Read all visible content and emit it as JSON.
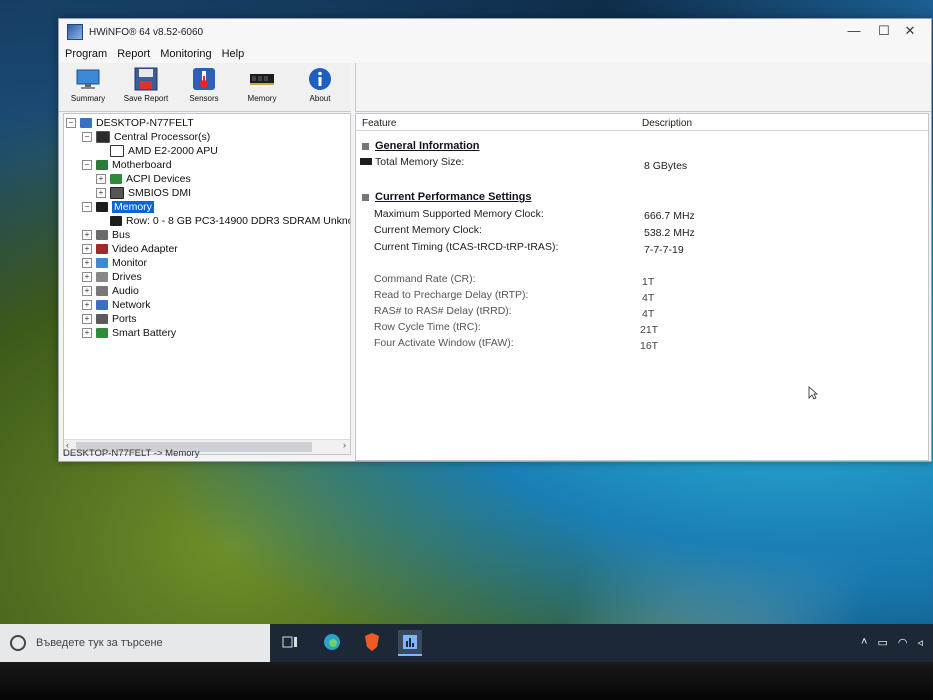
{
  "window": {
    "title": "HWiNFO® 64 v8.52-6060",
    "controls": {
      "minimize": "—",
      "maximize": "☐",
      "close": "✕"
    }
  },
  "menu": [
    "Program",
    "Report",
    "Monitoring",
    "Help"
  ],
  "toolbar": [
    {
      "label": "Summary",
      "icon": "summary-monitor-icon"
    },
    {
      "label": "Save Report",
      "icon": "floppy-disk-icon"
    },
    {
      "label": "Sensors",
      "icon": "thermometer-icon"
    },
    {
      "label": "Memory",
      "icon": "ram-module-icon"
    },
    {
      "label": "About",
      "icon": "info-icon"
    }
  ],
  "tree": {
    "root": "DESKTOP-N77FELT",
    "items": [
      {
        "label": "Central Processor(s)",
        "icon": "cpu-icon"
      },
      {
        "label": "AMD E2-2000 APU",
        "icon": "cpu-chip-icon"
      },
      {
        "label": "Motherboard",
        "icon": "motherboard-icon"
      },
      {
        "label": "ACPI Devices",
        "icon": "acpi-icon"
      },
      {
        "label": "SMBIOS DMI",
        "icon": "smbios-icon"
      },
      {
        "label": "Memory",
        "icon": "memory-icon"
      },
      {
        "label": "Row: 0 - 8 GB PC3-14900 DDR3 SDRAM Unkno",
        "icon": "ram-row-icon"
      },
      {
        "label": "Bus",
        "icon": "bus-icon"
      },
      {
        "label": "Video Adapter",
        "icon": "video-adapter-icon"
      },
      {
        "label": "Monitor",
        "icon": "monitor-icon"
      },
      {
        "label": "Drives",
        "icon": "drives-icon"
      },
      {
        "label": "Audio",
        "icon": "audio-icon"
      },
      {
        "label": "Network",
        "icon": "network-icon"
      },
      {
        "label": "Ports",
        "icon": "ports-icon"
      },
      {
        "label": "Smart Battery",
        "icon": "battery-icon"
      }
    ],
    "selected": "Memory"
  },
  "status": "DESKTOP-N77FELT -> Memory",
  "detail": {
    "headers": {
      "feature": "Feature",
      "description": "Description"
    },
    "sections": {
      "general": "General Information",
      "performance": "Current Performance Settings"
    },
    "rows": [
      {
        "feature": "Total Memory Size:",
        "value": "8 GBytes"
      },
      {
        "feature": "Maximum Supported Memory Clock:",
        "value": "666.7 MHz"
      },
      {
        "feature": "Current Memory Clock:",
        "value": "538.2 MHz"
      },
      {
        "feature": "Current Timing (tCAS-tRCD-tRP-tRAS):",
        "value": "7-7-7-19"
      },
      {
        "feature": "Command Rate (CR):",
        "value": "1T"
      },
      {
        "feature": "Read to Precharge Delay (tRTP):",
        "value": "4T"
      },
      {
        "feature": "RAS# to RAS# Delay (tRRD):",
        "value": "4T"
      },
      {
        "feature": "Row Cycle Time (tRC):",
        "value": "21T"
      },
      {
        "feature": "Four Activate Window (tFAW):",
        "value": "16T"
      }
    ]
  },
  "taskbar": {
    "search_placeholder": "Въведете тук за търсене",
    "apps": [
      "task-view-icon",
      "edge-browser-icon",
      "brave-browser-icon",
      "hwinfo-app-icon"
    ]
  }
}
